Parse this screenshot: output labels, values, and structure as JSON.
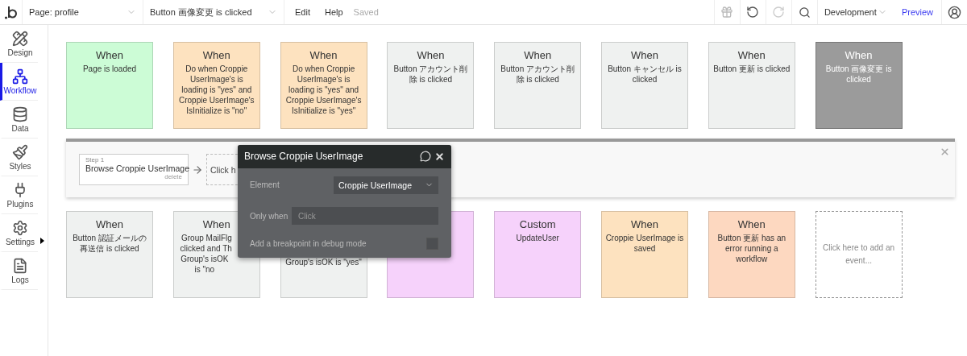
{
  "topbar": {
    "page_selector": "Page: profile",
    "event_selector": "Button 画像変更 is clicked",
    "menu": [
      "Edit",
      "Help"
    ],
    "status": "Saved",
    "environment": "Development",
    "preview": "Preview"
  },
  "sidebar": [
    {
      "label": "Design",
      "selected": false
    },
    {
      "label": "Workflow",
      "selected": true
    },
    {
      "label": "Data",
      "selected": false
    },
    {
      "label": "Styles",
      "selected": false
    },
    {
      "label": "Plugins",
      "selected": false
    },
    {
      "label": "Settings",
      "selected": false
    },
    {
      "label": "Logs",
      "selected": false
    }
  ],
  "events_row_1": [
    {
      "kind": "event",
      "color": "#ccfcd6",
      "title": "When",
      "text": "Page is loaded",
      "selected": false
    },
    {
      "kind": "event",
      "color": "#fde2bf",
      "title": "When",
      "text": "Do when Croppie UserImage's is loading is \"yes\" and Croppie UserImage's IsInitialize is \"no\"",
      "selected": false
    },
    {
      "kind": "event",
      "color": "#fde2bf",
      "title": "When",
      "text": "Do when Croppie UserImage's is loading is \"yes\" and Croppie UserImage's IsInitialize is \"yes\"",
      "selected": false
    },
    {
      "kind": "event",
      "color": "#eff1f0",
      "title": "When",
      "text": "Button アカウント削除 is clicked",
      "selected": false
    },
    {
      "kind": "event",
      "color": "#eff1f0",
      "title": "When",
      "text": "Button アカウント削除 is clicked",
      "selected": false
    },
    {
      "kind": "event",
      "color": "#eff1f0",
      "title": "When",
      "text": "Button キャンセル is clicked",
      "selected": false
    },
    {
      "kind": "event",
      "color": "#eff1f0",
      "title": "When",
      "text": "Button 更新 is clicked",
      "selected": false
    },
    {
      "kind": "event",
      "color": "#9b9b9b",
      "title": "When",
      "text": "Button 画像変更 is clicked",
      "selected": true
    }
  ],
  "workflow_panel": {
    "step_label": "Step 1",
    "step_action": "Browse Croppie UserImage",
    "delete": "delete",
    "add_action": "Click h"
  },
  "events_row_2": [
    {
      "kind": "event",
      "color": "#eff1f0",
      "title": "When",
      "text": "Button 認証メールの再送信 is clicked",
      "selected": false
    },
    {
      "kind": "covered",
      "color": "#eff1f0",
      "title": "When",
      "lines": [
        "Group MailFlg",
        "clicked and Th",
        "Group's isOK is \"no"
      ],
      "selected": false
    },
    {
      "kind": "covered",
      "color": "#eff1f0",
      "lines": [
        "Group's isOK is \"yes\""
      ],
      "selected": false
    },
    {
      "kind": "covered",
      "color": "#f6d2fb",
      "selected": false
    },
    {
      "kind": "event",
      "color": "#f6d2fb",
      "title": "Custom",
      "text": "UpdateUser",
      "selected": false
    },
    {
      "kind": "event",
      "color": "#fde2bf",
      "title": "When",
      "text": "Croppie UserImage is saved",
      "selected": false
    },
    {
      "kind": "event",
      "color": "#fdd8c0",
      "title": "When",
      "text": "Button 更新 has an error running a workflow",
      "selected": false
    },
    {
      "kind": "add",
      "text": "Click here to add an event..."
    }
  ],
  "popup": {
    "title": "Browse Croppie UserImage",
    "element_label": "Element",
    "element_value": "Croppie UserImage",
    "only_when_label": "Only when",
    "only_when_placeholder": "Click",
    "breakpoint_label": "Add a breakpoint in debug mode",
    "breakpoint_checked": false
  }
}
